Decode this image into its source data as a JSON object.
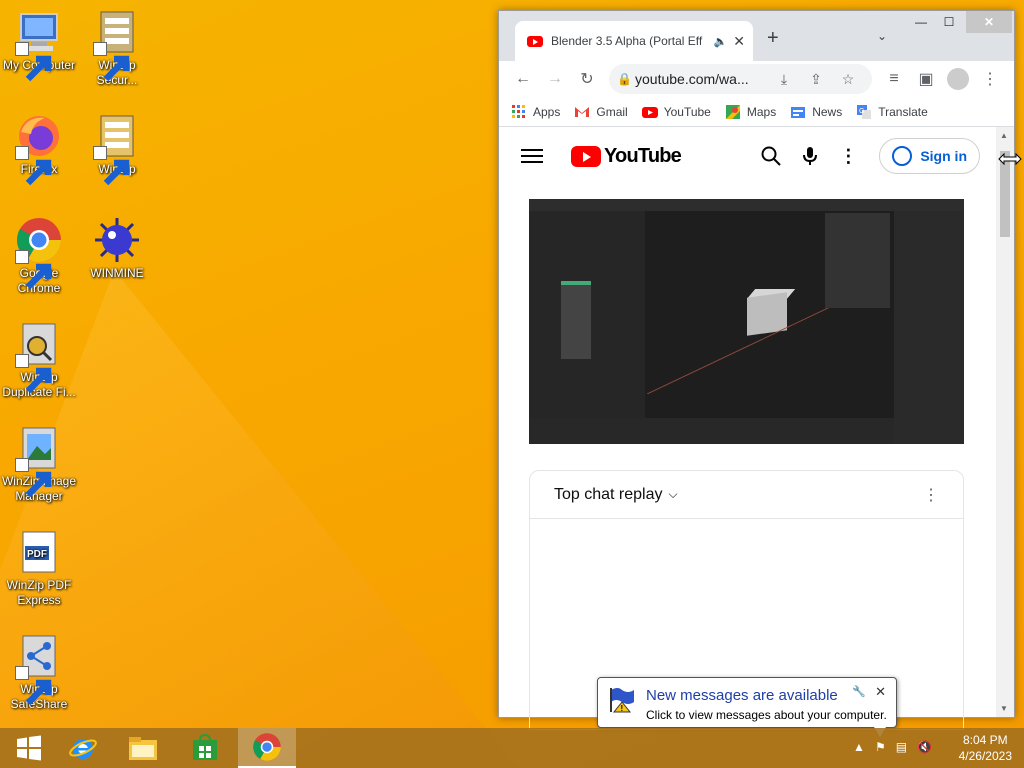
{
  "desktop": {
    "icons": [
      {
        "label": "My Computer",
        "icon": "computer-icon"
      },
      {
        "label": "WinZip Secur...",
        "icon": "winzip-secure-icon"
      },
      {
        "label": "Firefox",
        "icon": "firefox-icon"
      },
      {
        "label": "WinZip",
        "icon": "winzip-icon"
      },
      {
        "label": "Google Chrome",
        "icon": "chrome-icon"
      },
      {
        "label": "WINMINE",
        "icon": "mine-icon"
      },
      {
        "label": "WinZip Duplicate Fi...",
        "icon": "winzip-duplicate-icon"
      },
      {
        "label": "WinZip Image Manager",
        "icon": "winzip-image-icon"
      },
      {
        "label": "WinZip PDF Express",
        "icon": "winzip-pdf-icon"
      },
      {
        "label": "WinZip SafeShare",
        "icon": "winzip-safeshare-icon"
      }
    ]
  },
  "browser": {
    "tab_title": "Blender 3.5 Alpha (Portal Eff",
    "tab_audio": "🔈",
    "tab_close": "✕",
    "new_tab": "+",
    "tab_dropdown": "⌄",
    "minimize": "—",
    "maximize": "☐",
    "close": "✕",
    "url": "youtube.com/wa...",
    "bookmarks": [
      {
        "label": "Apps",
        "icon": "apps-grid-icon"
      },
      {
        "label": "Gmail",
        "icon": "gmail-icon"
      },
      {
        "label": "YouTube",
        "icon": "youtube-icon"
      },
      {
        "label": "Maps",
        "icon": "maps-icon"
      },
      {
        "label": "News",
        "icon": "news-icon"
      },
      {
        "label": "Translate",
        "icon": "translate-icon"
      }
    ]
  },
  "youtube": {
    "logo_text": "YouTube",
    "sign_in": "Sign in",
    "chat_title": "Top chat replay",
    "chat_chevron": "⌵",
    "chat_menu": "⋮"
  },
  "notification": {
    "title": "New messages are available",
    "subtitle": "Click to view messages about your computer.",
    "close": "✕"
  },
  "taskbar": {
    "time": "8:04 PM",
    "date": "4/26/2023",
    "apps": [
      "start-icon",
      "ie-icon",
      "file-explorer-icon",
      "store-icon",
      "chrome-icon"
    ]
  },
  "colors": {
    "desktop": "#f6b400",
    "youtube_red": "#ff0000",
    "signin_blue": "#065fd4",
    "balloon_title": "#1f3ea8"
  }
}
